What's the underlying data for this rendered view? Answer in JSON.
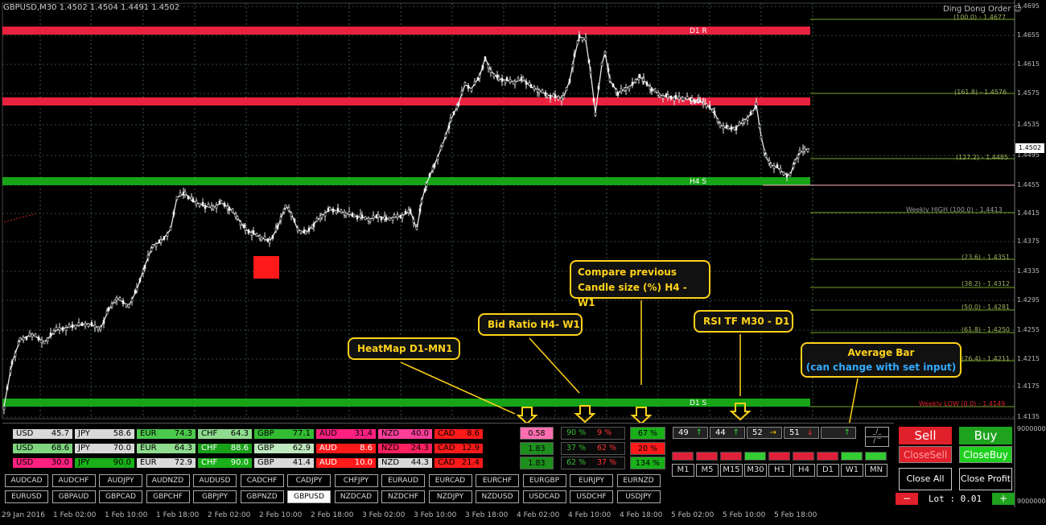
{
  "header": {
    "symbol_info": "GBPUSD,M30  1.4502 1.4504 1.4491 1.4502",
    "ea_name": "Ding Dong Order"
  },
  "price_axis": {
    "labels": [
      "1.4695",
      "1.4655",
      "1.4615",
      "1.4575",
      "1.4535",
      "1.4495",
      "1.4455",
      "1.4415",
      "1.4375",
      "1.4335",
      "1.4295",
      "1.4255",
      "1.4215",
      "1.4175",
      "1.4135",
      "9000000",
      "9000000"
    ],
    "current_price": "1.4502"
  },
  "time_axis": {
    "labels": [
      "29 Jan 2016",
      "1 Feb 02:00",
      "1 Feb 10:00",
      "1 Feb 18:00",
      "2 Feb 02:00",
      "2 Feb 10:00",
      "2 Feb 18:00",
      "3 Feb 02:00",
      "3 Feb 10:00",
      "3 Feb 18:00",
      "4 Feb 02:00",
      "4 Feb 10:00",
      "4 Feb 18:00",
      "5 Feb 02:00",
      "5 Feb 10:00",
      "5 Feb 18:00"
    ]
  },
  "levels": {
    "d1r": "D1 R",
    "h4r": "H4 R",
    "h4s": "H4 S",
    "d1s": "D1 S",
    "fib": [
      "(100.0) - 1.4677",
      "(161.8) - 1.4576",
      "(127.2) - 1.4485",
      "Weekly HIGH (100.0) - 1.4413",
      "(23.6) - 1.4351",
      "(38.2) - 1.4312",
      "(50.0) - 1.4281",
      "(61.8) - 1.4250",
      "(76.4) - 1.4211",
      "Weekly LOW (0.0) - 1.4149"
    ]
  },
  "annotations": {
    "heatmap": "HeatMap D1-MN1",
    "bid_ratio": "Bid Ratio H4- W1",
    "compare_line1": "Compare previous",
    "compare_line2": "Candle size (%) H4 - W1",
    "rsi": "RSI TF M30 - D1",
    "avg_line1": "Average Bar",
    "avg_line2": "(can change with set input)"
  },
  "heatmap": [
    [
      {
        "c": "USD",
        "v": "45.7",
        "bg": "#d9d9d9",
        "fg": "#000"
      },
      {
        "c": "JPY",
        "v": "58.6",
        "bg": "#d9d9d9",
        "fg": "#000"
      },
      {
        "c": "EUR",
        "v": "74.3",
        "bg": "#4cc84c",
        "fg": "#000"
      },
      {
        "c": "CHF",
        "v": "64.3",
        "bg": "#8fdc8f",
        "fg": "#000"
      },
      {
        "c": "GBP",
        "v": "77.1",
        "bg": "#33bb33",
        "fg": "#000"
      },
      {
        "c": "AUD",
        "v": "31.4",
        "bg": "#ff2080",
        "fg": "#000"
      },
      {
        "c": "NZD",
        "v": "40.0",
        "bg": "#ff3f9a",
        "fg": "#000"
      },
      {
        "c": "CAD",
        "v": "8.6",
        "bg": "#ff1a1a",
        "fg": "#000"
      }
    ],
    [
      {
        "c": "USD",
        "v": "68.6",
        "bg": "#7fd67f",
        "fg": "#000"
      },
      {
        "c": "JPY",
        "v": "70.0",
        "bg": "#d9d9d9",
        "fg": "#000"
      },
      {
        "c": "EUR",
        "v": "64.3",
        "bg": "#8fdc8f",
        "fg": "#000"
      },
      {
        "c": "CHF",
        "v": "88.6",
        "bg": "#19a019",
        "fg": "#fff"
      },
      {
        "c": "GBP",
        "v": "62.9",
        "bg": "#bfe8bf",
        "fg": "#000"
      },
      {
        "c": "AUD",
        "v": "8.6",
        "bg": "#ff1a1a",
        "fg": "#fff"
      },
      {
        "c": "NZD",
        "v": "24.3",
        "bg": "#ff2060",
        "fg": "#000"
      },
      {
        "c": "CAD",
        "v": "12.9",
        "bg": "#ff1a1a",
        "fg": "#000"
      }
    ],
    [
      {
        "c": "USD",
        "v": "30.0",
        "bg": "#ff2080",
        "fg": "#000"
      },
      {
        "c": "JPY",
        "v": "90.0",
        "bg": "#19b019",
        "fg": "#000"
      },
      {
        "c": "EUR",
        "v": "72.9",
        "bg": "#d9d9d9",
        "fg": "#000"
      },
      {
        "c": "CHF",
        "v": "90.0",
        "bg": "#19b019",
        "fg": "#fff"
      },
      {
        "c": "GBP",
        "v": "41.4",
        "bg": "#d9d9d9",
        "fg": "#000"
      },
      {
        "c": "AUD",
        "v": "10.0",
        "bg": "#ff1a1a",
        "fg": "#fff"
      },
      {
        "c": "NZD",
        "v": "44.3",
        "bg": "#d9d9d9",
        "fg": "#000"
      },
      {
        "c": "CAD",
        "v": "21.4",
        "bg": "#ff1a1a",
        "fg": "#000"
      }
    ]
  ],
  "pairs": [
    [
      "AUDCAD",
      "AUDCHF",
      "AUDJPY",
      "AUDNZD",
      "AUDUSD",
      "CADCHF",
      "CADJPY",
      "CHFJPY",
      "EURAUD",
      "EURCAD",
      "EURCHF",
      "EURGBP",
      "EURJPY",
      "EURNZD"
    ],
    [
      "EURUSD",
      "GBPAUD",
      "GBPCAD",
      "GBPCHF",
      "GBPJPY",
      "GBPNZD",
      "GBPUSD",
      "NZDCAD",
      "NZDCHF",
      "NZDJPY",
      "NZDUSD",
      "USDCAD",
      "USDCHF",
      "USDJPY"
    ]
  ],
  "selected_pair": "GBPUSD",
  "bid_ratio": {
    "top": "0.58",
    "mid": "1.83",
    "bot": "1.83"
  },
  "compare_pct": [
    [
      "90 %",
      "9 %"
    ],
    [
      "37 %",
      "62 %"
    ],
    [
      "62 %",
      "37 %"
    ]
  ],
  "compare_single": [
    "67 %",
    "20 %",
    "134 %"
  ],
  "rsi": [
    {
      "v": "49",
      "a": "↑",
      "col": "#33dd33"
    },
    {
      "v": "44",
      "a": "↑",
      "col": "#33dd33"
    },
    {
      "v": "52",
      "a": "→",
      "col": "#ffcc00"
    },
    {
      "v": "51",
      "a": "↓",
      "col": "#ff3333"
    },
    {
      "v": "",
      "a": "↑",
      "col": "#33dd33"
    }
  ],
  "small_buttons": [
    "_/_",
    "/ ‾"
  ],
  "timeframes": [
    "M1",
    "M5",
    "M15",
    "M30",
    "H1",
    "H4",
    "D1",
    "W1",
    "MN"
  ],
  "avg_bar_colors": [
    "#e0203a",
    "#e0203a",
    "#e0203a",
    "#33cc33",
    "#e0203a",
    "#e0203a",
    "#e0203a",
    "#33cc33",
    "#33cc33"
  ],
  "trade": {
    "sell": "Sell",
    "buy": "Buy",
    "close_sell": "CloseSell",
    "close_buy": "CloseBuy",
    "close_all": "Close All",
    "close_profit": "Close Profit",
    "minus": "−",
    "plus": "+",
    "lot": "Lot :  0.01"
  }
}
